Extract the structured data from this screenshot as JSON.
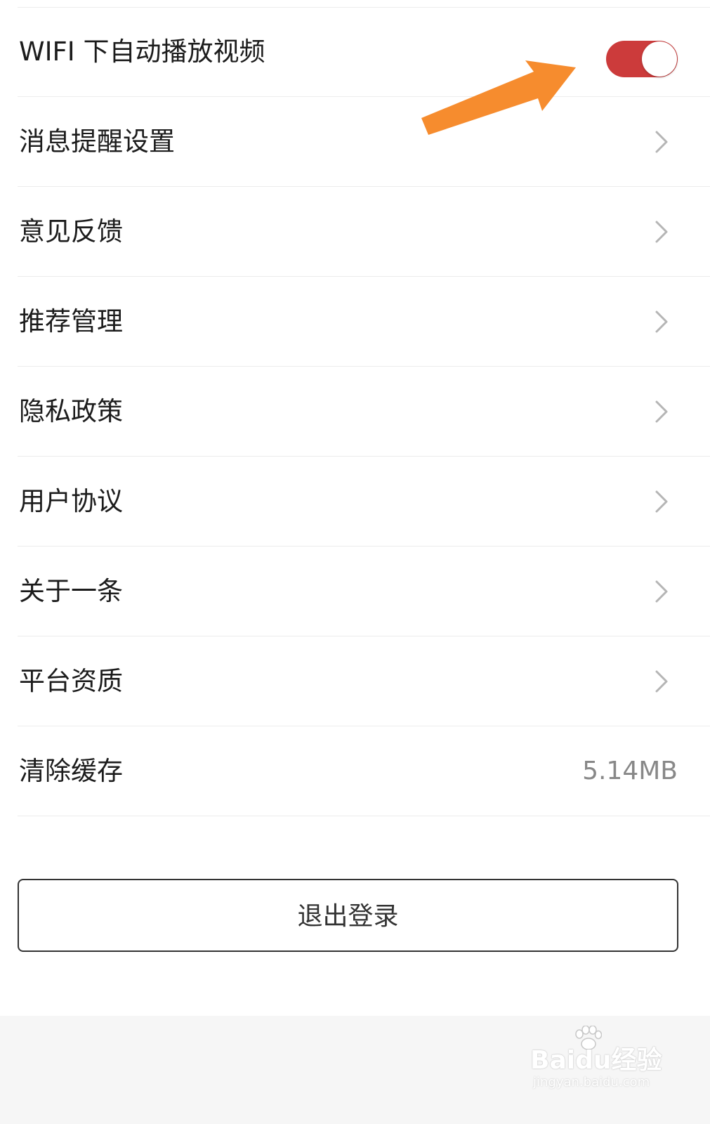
{
  "settings": {
    "wifi_autoplay": {
      "label": "WIFI 下自动播放视频",
      "enabled": true,
      "toggle_color": "#cc3b3b"
    },
    "items": [
      {
        "label": "消息提醒设置"
      },
      {
        "label": "意见反馈"
      },
      {
        "label": "推荐管理"
      },
      {
        "label": "隐私政策"
      },
      {
        "label": "用户协议"
      },
      {
        "label": "关于一条"
      },
      {
        "label": "平台资质"
      }
    ],
    "clear_cache": {
      "label": "清除缓存",
      "value": "5.14MB"
    }
  },
  "logout": {
    "label": "退出登录"
  },
  "annotation": {
    "arrow_color": "#f68c2e"
  },
  "watermark": {
    "logo_text": "Baidu经验",
    "url": "jingyan.baidu.com"
  }
}
